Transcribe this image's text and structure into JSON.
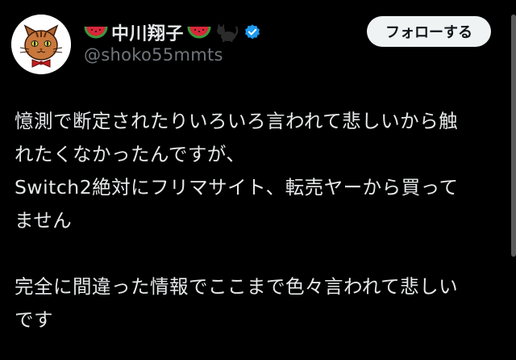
{
  "author": {
    "display_name": "中川翔子",
    "handle": "@shoko55mmts",
    "verified": true,
    "name_emoji": [
      "watermelon-icon",
      "watermelon-icon",
      "black-cat-icon"
    ]
  },
  "actions": {
    "follow_label": "フォローする"
  },
  "post": {
    "lines": [
      "憶測で断定されたりいろいろ言われて悲しいから触",
      "れたくなかったんですが、",
      "Switch2絶対にフリマサイト、転売ヤーから買って",
      "ません",
      "",
      "完全に間違った情報でここまで色々言われて悲しい",
      "です"
    ]
  },
  "colors": {
    "background": "#000000",
    "text": "#e7e9ea",
    "muted": "#71767b",
    "verified": "#1d9bf0",
    "follow_bg": "#eff3f4"
  }
}
